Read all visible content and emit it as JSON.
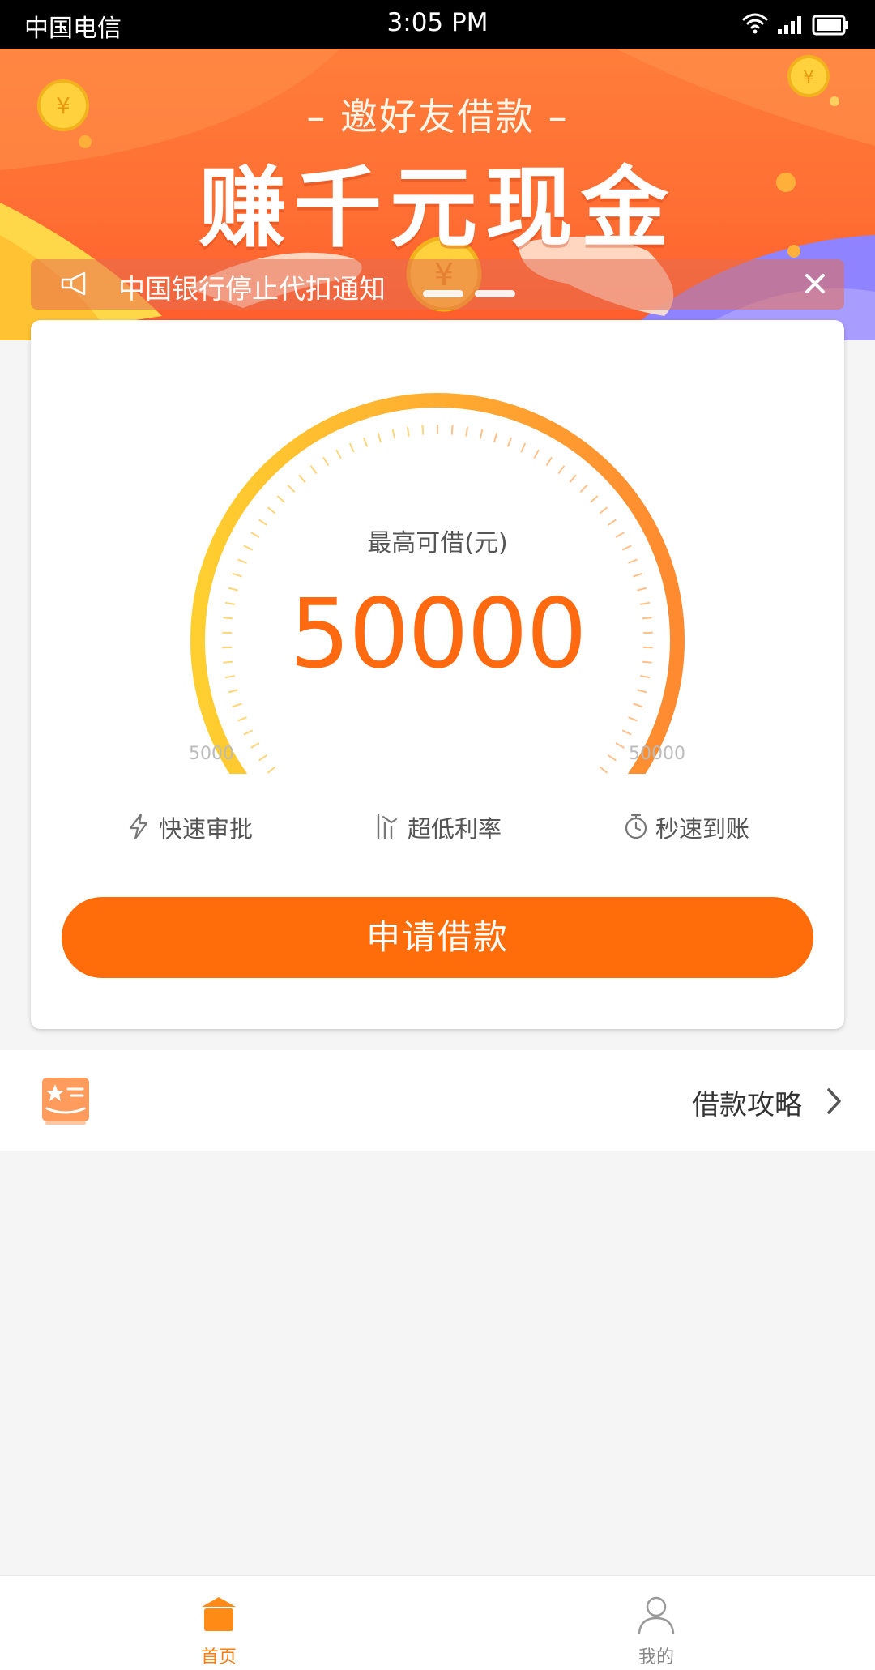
{
  "status_bar": {
    "carrier": "中国电信",
    "time": "3:05 PM"
  },
  "banner": {
    "subtitle": "– 邀好友借款 –",
    "headline": "赚千元现金",
    "notice": "中国银行停止代扣通知",
    "carousel_pages": 2,
    "carousel_active": 1
  },
  "gauge": {
    "caption": "最高可借(元)",
    "amount": "50000",
    "min_label": "5000",
    "max_label": "50000",
    "level_fraction": 1.0
  },
  "features": [
    {
      "label": "快速审批",
      "icon": "lightning-icon"
    },
    {
      "label": "超低利率",
      "icon": "rate-chart-icon"
    },
    {
      "label": "秒速到账",
      "icon": "stopwatch-icon"
    }
  ],
  "apply_button": "申请借款",
  "guide": {
    "label": "借款攻略",
    "icon": "star-card-icon"
  },
  "tabs": [
    {
      "label": "首页",
      "icon": "home-icon",
      "active": true
    },
    {
      "label": "我的",
      "icon": "user-icon",
      "active": false
    }
  ],
  "colors": {
    "accent": "#ff6d0a",
    "banner": "#ff7438",
    "gauge_start": "#ffcf30",
    "gauge_end": "#ff8a30",
    "tab_active": "#ff7d0f"
  }
}
